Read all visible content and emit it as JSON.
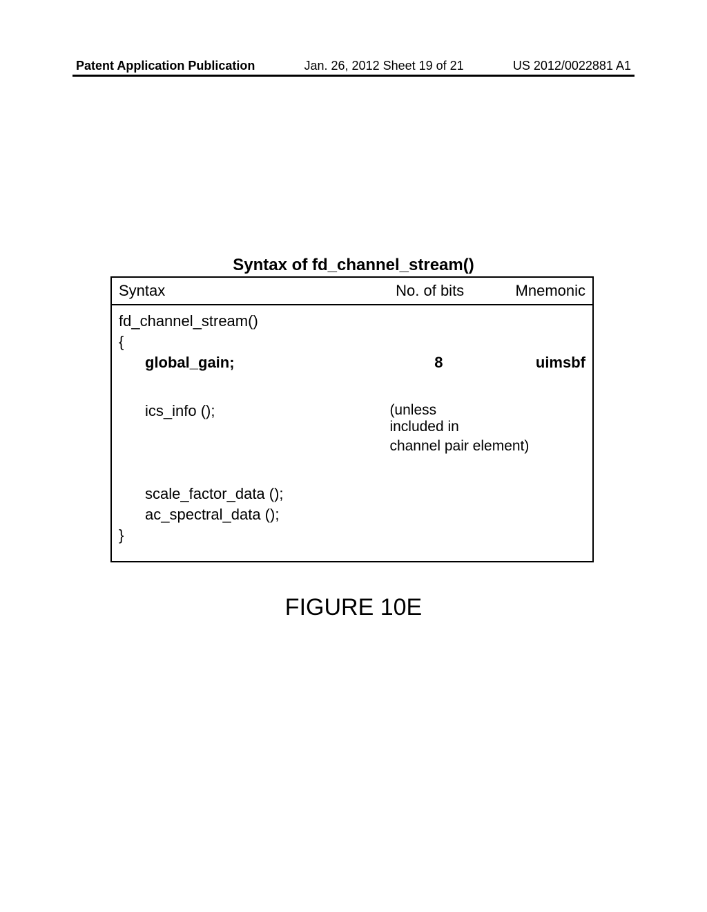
{
  "header": {
    "left": "Patent Application Publication",
    "center": "Jan. 26, 2012  Sheet 19 of 21",
    "right": "US 2012/0022881 A1"
  },
  "table": {
    "title": "Syntax of fd_channel_stream()",
    "headers": {
      "syntax": "Syntax",
      "bits": "No. of bits",
      "mnemonic": "Mnemonic"
    },
    "rows": {
      "fn_name": "fd_channel_stream()",
      "brace_open": "{",
      "global_gain": "global_gain;",
      "global_gain_bits": "8",
      "global_gain_mnemonic": "uimsbf",
      "ics_info": "ics_info ();",
      "ics_note_line1": "(unless included in",
      "ics_note_line2": "channel pair element)",
      "scale_factor": "scale_factor_data ();",
      "ac_spectral": "ac_spectral_data ();",
      "brace_close": "}"
    }
  },
  "figure_label": "FIGURE 10E"
}
